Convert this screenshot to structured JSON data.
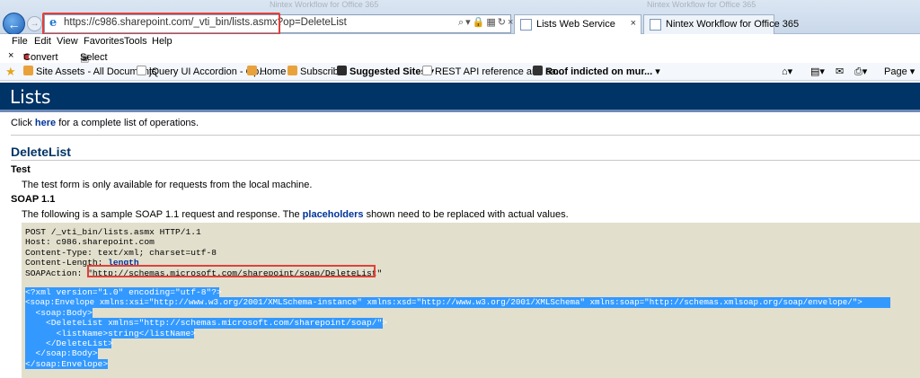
{
  "browser": {
    "address": "https://c986.sharepoint.com/_vti_bin/lists.asmx?op=DeleteList",
    "ghost_tabs": [
      "Nintex Workflow for Office 365",
      "Nintex Workflow for Office 365"
    ],
    "tabs": [
      {
        "label": "Lists Web Service",
        "active": true
      },
      {
        "label": "Nintex Workflow for Office 365",
        "active": false
      }
    ],
    "menu": [
      "File",
      "Edit",
      "View",
      "Favorites",
      "Tools",
      "Help"
    ],
    "command": {
      "convert": "Convert",
      "select": "Select"
    },
    "favorites": [
      "Site Assets - All Documents",
      "jQuery UI Accordion - Op...",
      "Home",
      "Subscribe",
      "Suggested Sites ▾",
      "REST API reference and sa...",
      "Roof indicted on mur..."
    ],
    "page_menu": "Page ▾",
    "colors": {
      "header": "#003366",
      "selection": "#3399ff",
      "highlight": "#e0403a",
      "code_bg": "#e2dfcc"
    }
  },
  "page": {
    "title": "Lists",
    "intro_before": "Click ",
    "intro_link": "here",
    "intro_after": " for a complete list of operations.",
    "operation": "DeleteList",
    "test_heading": "Test",
    "test_text": "The test form is only available for requests from the local machine.",
    "soap_heading": "SOAP 1.1",
    "soap_text_before": "The following is a sample SOAP 1.1 request and response. The ",
    "soap_text_link": "placeholders",
    "soap_text_after": " shown need to be replaced with actual values.",
    "code": {
      "line1": "POST /_vti_bin/lists.asmx HTTP/1.1",
      "line2": "Host: c986.sharepoint.com",
      "line3": "Content-Type: text/xml; charset=utf-8",
      "line4_label": "Content-Length: ",
      "line4_value": "length",
      "line5_label": "SOAPAction: ",
      "line5_value": "\"http://schemas.microsoft.com/sharepoint/soap/DeleteList\"",
      "xml": [
        "<?xml version=\"1.0\" encoding=\"utf-8\"?>",
        "<soap:Envelope xmlns:xsi=\"http://www.w3.org/2001/XMLSchema-instance\" xmlns:xsd=\"http://www.w3.org/2001/XMLSchema\" xmlns:soap=\"http://schemas.xmlsoap.org/soap/envelope/\">",
        "  <soap:Body>",
        "    <DeleteList xmlns=\"http://schemas.microsoft.com/sharepoint/soap/\">",
        "      <listName>string</listName>",
        "    </DeleteList>",
        "  </soap:Body>",
        "</soap:Envelope>"
      ]
    }
  }
}
